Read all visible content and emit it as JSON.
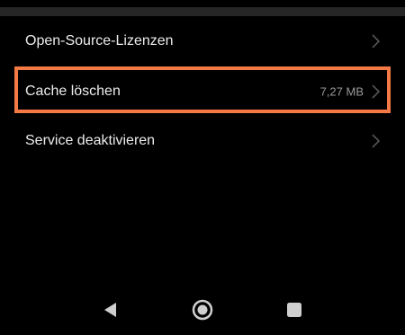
{
  "settings": {
    "items": [
      {
        "label": "Open-Source-Lizenzen",
        "value": ""
      },
      {
        "label": "Cache löschen",
        "value": "7,27 MB"
      },
      {
        "label": "Service deaktivieren",
        "value": ""
      }
    ]
  },
  "highlight": {
    "color": "#f47a45"
  },
  "nav": {
    "back_icon": "back-triangle-icon",
    "home_icon": "home-circle-icon",
    "recents_icon": "recents-square-icon"
  }
}
